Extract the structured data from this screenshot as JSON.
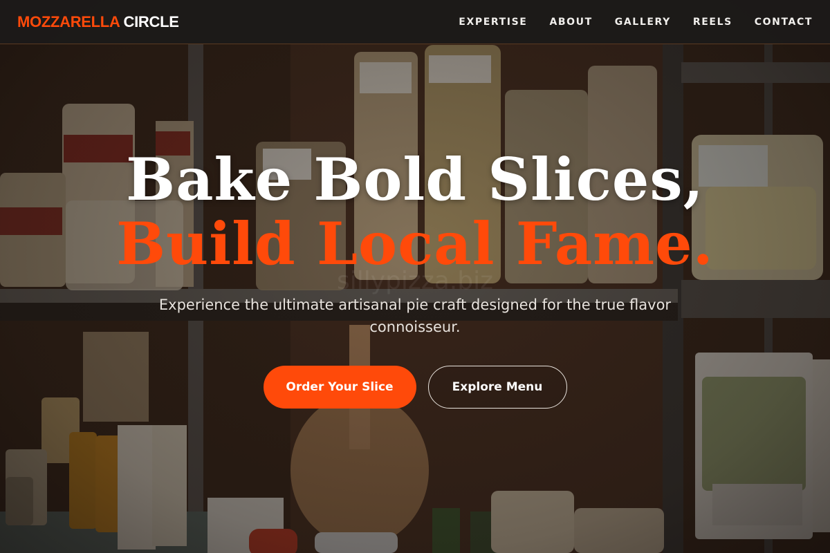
{
  "brand": {
    "name_part1": "MOZZARELLA",
    "name_part2": "CIRCLE",
    "accent_color": "#ff4a0a"
  },
  "nav": {
    "items": [
      {
        "label": "EXPERTISE"
      },
      {
        "label": "ABOUT"
      },
      {
        "label": "GALLERY"
      },
      {
        "label": "REELS"
      },
      {
        "label": "CONTACT"
      }
    ]
  },
  "hero": {
    "title_line1": "Bake Bold Slices,",
    "title_line2": "Build Local Fame.",
    "subtitle": "Experience the ultimate artisanal pie craft designed for the true flavor connoisseur.",
    "primary_button": "Order Your Slice",
    "secondary_button": "Explore Menu",
    "watermark": "sillypizza.biz",
    "background_image": "pantry-shelves-with-pasta-bags-and-jars"
  }
}
